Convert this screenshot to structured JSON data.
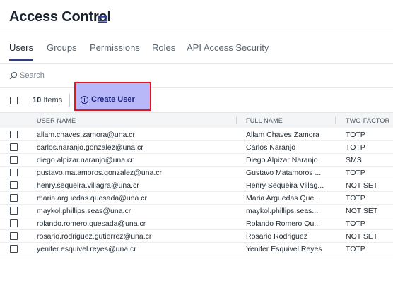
{
  "header": {
    "title": "Access Control",
    "title_icon": "window-icon"
  },
  "tabs": [
    {
      "label": "Users",
      "active": true
    },
    {
      "label": "Groups",
      "active": false
    },
    {
      "label": "Permissions",
      "active": false
    },
    {
      "label": "Roles",
      "active": false
    },
    {
      "label": "API Access Security",
      "active": false
    }
  ],
  "search": {
    "placeholder": "Search"
  },
  "toolbar": {
    "count": "10",
    "count_suffix": "Items",
    "create_label": "Create User"
  },
  "table": {
    "columns": [
      "USER NAME",
      "FULL NAME",
      "TWO-FACTOR"
    ],
    "rows": [
      {
        "user": "allam.chaves.zamora@una.cr",
        "name": "Allam Chaves Zamora",
        "tfa": "TOTP"
      },
      {
        "user": "carlos.naranjo.gonzalez@una.cr",
        "name": "Carlos Naranjo",
        "tfa": "TOTP"
      },
      {
        "user": "diego.alpizar.naranjo@una.cr",
        "name": "Diego Alpizar Naranjo",
        "tfa": "SMS"
      },
      {
        "user": "gustavo.matamoros.gonzalez@una.cr",
        "name": "Gustavo Matamoros ...",
        "tfa": "TOTP"
      },
      {
        "user": "henry.sequeira.villagra@una.cr",
        "name": "Henry Sequeira Villag...",
        "tfa": "NOT SET"
      },
      {
        "user": "maria.arguedas.quesada@una.cr",
        "name": "Maria Arguedas Que...",
        "tfa": "TOTP"
      },
      {
        "user": "maykol.phillips.seas@una.cr",
        "name": "maykol.phillips.seas...",
        "tfa": "NOT SET"
      },
      {
        "user": "rolando.romero.quesada@una.cr",
        "name": "Rolando Romero Qu...",
        "tfa": "TOTP"
      },
      {
        "user": "rosario.rodriguez.gutierrez@una.cr",
        "name": "Rosario Rodriguez",
        "tfa": "NOT SET"
      },
      {
        "user": "yenifer.esquivel.reyes@una.cr",
        "name": "Yenifer Esquivel Reyes",
        "tfa": "TOTP"
      }
    ]
  },
  "colors": {
    "accent": "#2f3a8c",
    "highlight_fill": "#b8b8f8",
    "highlight_border": "#e8141c"
  }
}
